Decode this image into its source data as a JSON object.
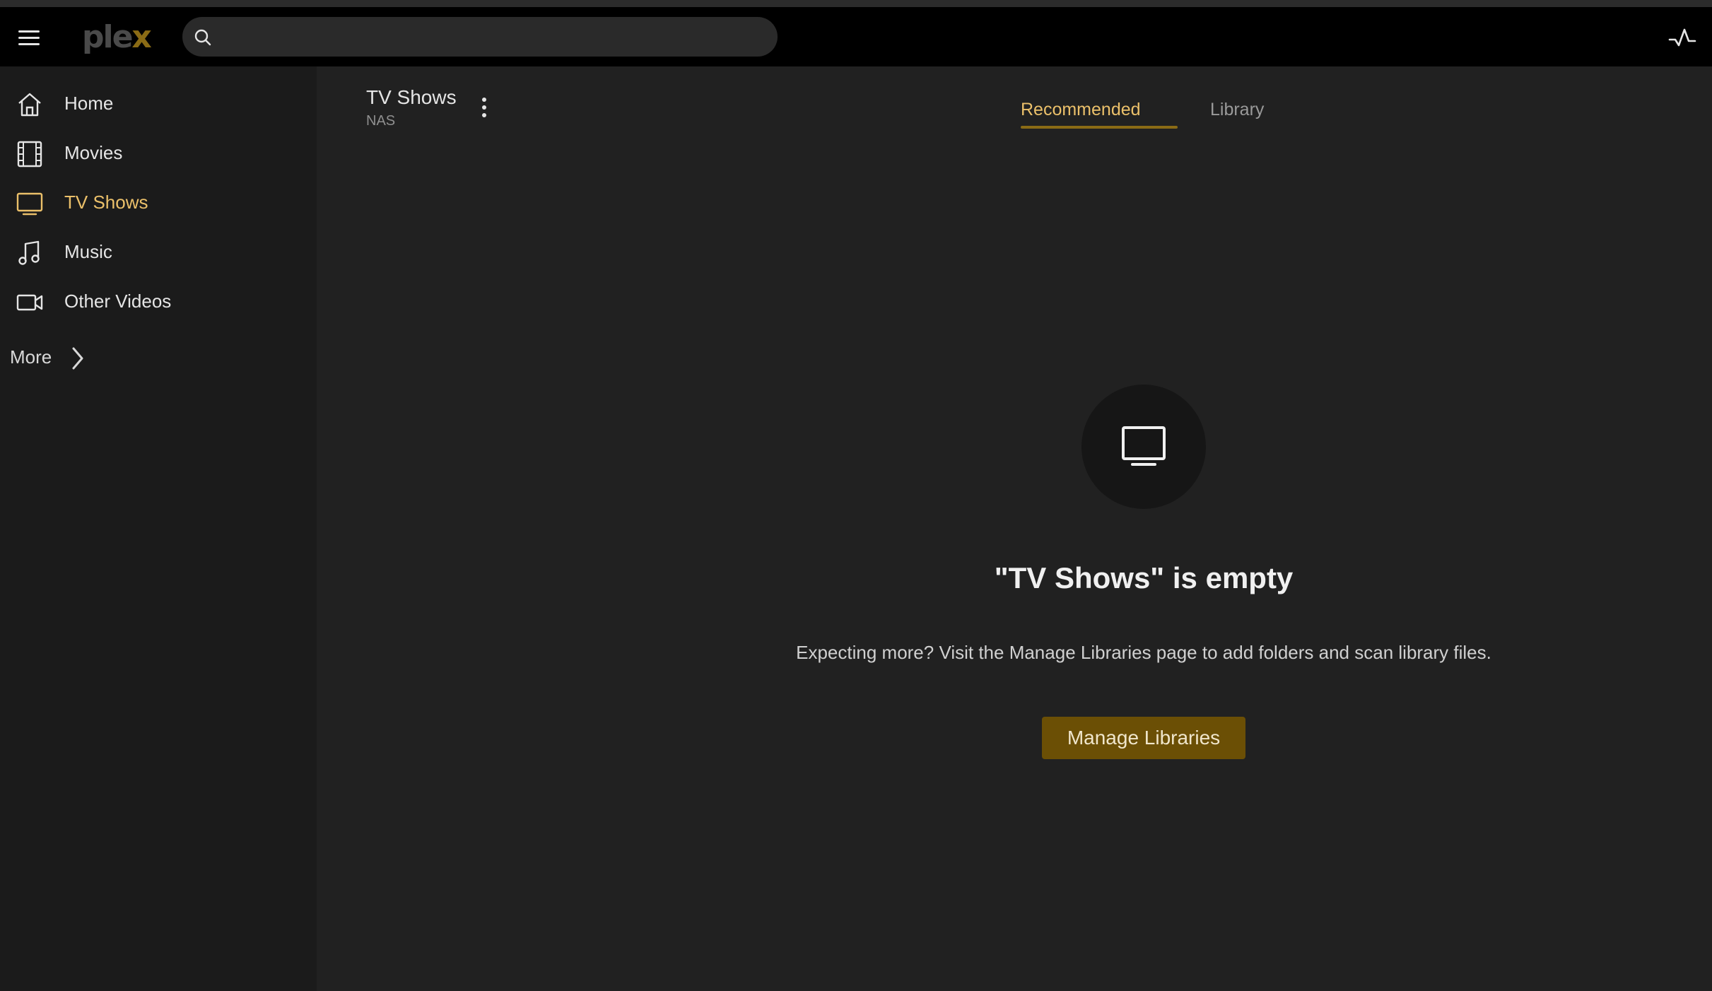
{
  "app": {
    "logo_text_main": "ple",
    "logo_text_accent": "x",
    "brand_accent_color": "#e5a00d"
  },
  "search": {
    "placeholder": "",
    "value": ""
  },
  "sidebar": {
    "items": [
      {
        "label": "Home",
        "icon": "home-icon"
      },
      {
        "label": "Movies",
        "icon": "film-icon"
      },
      {
        "label": "TV Shows",
        "icon": "tv-icon",
        "active": true
      },
      {
        "label": "Music",
        "icon": "music-note-icon"
      },
      {
        "label": "Other Videos",
        "icon": "video-camera-icon"
      }
    ],
    "more_label": "More"
  },
  "library": {
    "title": "TV Shows",
    "subtitle": "NAS"
  },
  "tabs": [
    {
      "label": "Recommended",
      "active": true
    },
    {
      "label": "Library",
      "active": false
    }
  ],
  "empty_state": {
    "icon": "tv-icon",
    "title": "\"TV Shows\" is empty",
    "description": "Expecting more? Visit the Manage Libraries page to add folders and scan library files.",
    "button_label": "Manage Libraries"
  }
}
